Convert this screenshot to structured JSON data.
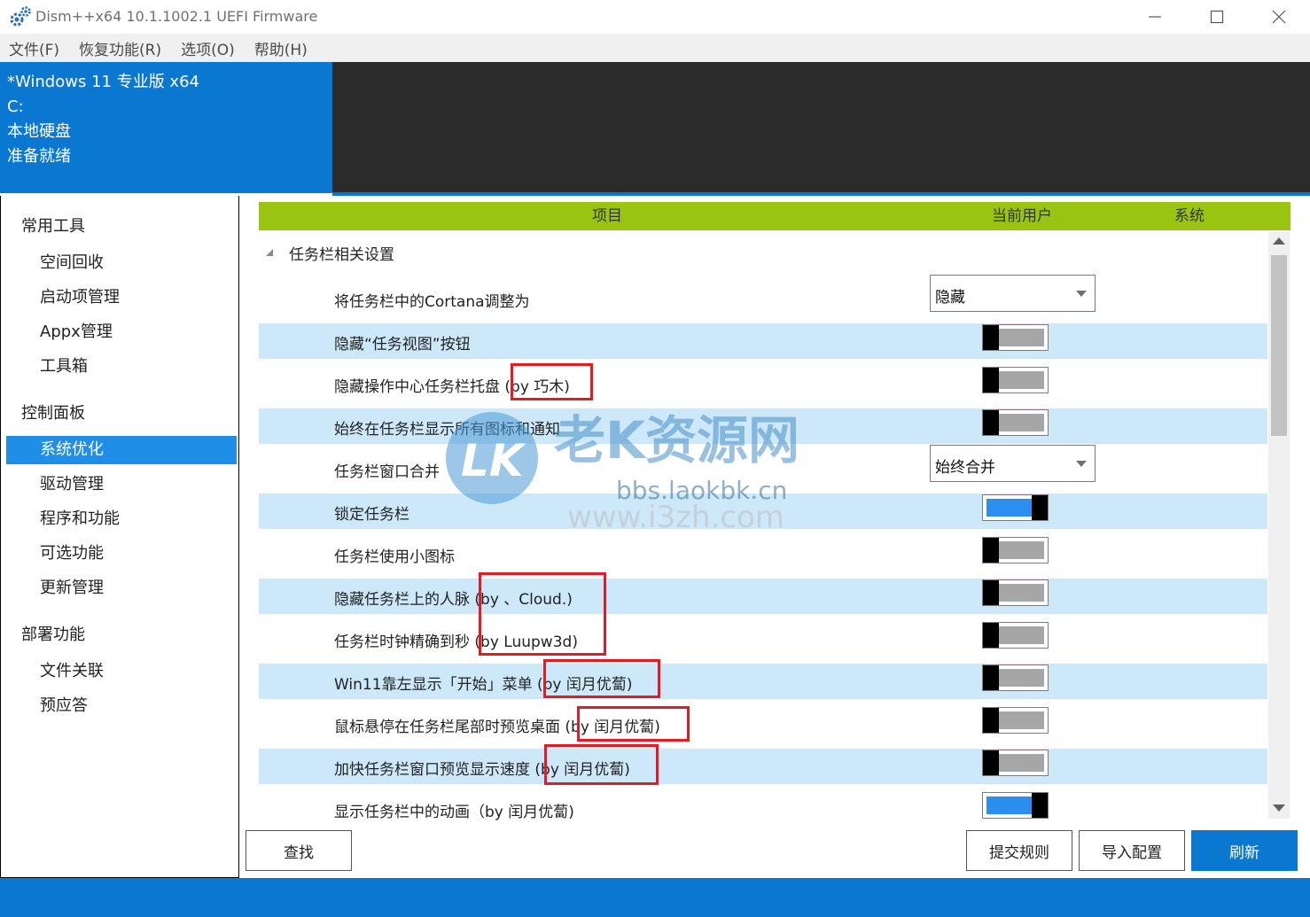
{
  "window": {
    "title": "Dism++x64 10.1.1002.1 UEFI Firmware",
    "minimize_icon": "minimize-icon",
    "maximize_icon": "maximize-icon",
    "close_icon": "close-icon"
  },
  "menu": [
    "文件(F)",
    "恢复功能(R)",
    "选项(O)",
    "帮助(H)"
  ],
  "image_info": {
    "name": "*Windows 11 专业版 x64",
    "drive": "C:",
    "type": "本地硬盘",
    "status": "准备就绪"
  },
  "sidebar": {
    "groups": [
      {
        "label": "常用工具",
        "items": [
          "空间回收",
          "启动项管理",
          "Appx管理",
          "工具箱"
        ]
      },
      {
        "label": "控制面板",
        "items": [
          "系统优化",
          "驱动管理",
          "程序和功能",
          "可选功能",
          "更新管理"
        ]
      },
      {
        "label": "部署功能",
        "items": [
          "文件关联",
          "预应答"
        ]
      }
    ],
    "active": "系统优化"
  },
  "table": {
    "columns": [
      "项目",
      "当前用户",
      "系统"
    ],
    "group_title": "任务栏相关设置",
    "rows": [
      {
        "label": "将任务栏中的Cortana调整为",
        "control": "dropdown",
        "value": "隐藏"
      },
      {
        "label": "隐藏“任务视图”按钮",
        "control": "toggle",
        "on": false
      },
      {
        "label": "隐藏操作中心任务栏托盘",
        "credit": "(by 巧木)",
        "control": "toggle",
        "on": false
      },
      {
        "label": "始终在任务栏显示所有图标和通知",
        "control": "toggle",
        "on": false
      },
      {
        "label": "任务栏窗口合并",
        "control": "dropdown",
        "value": "始终合并"
      },
      {
        "label": "锁定任务栏",
        "control": "toggle",
        "on": true
      },
      {
        "label": "任务栏使用小图标",
        "control": "toggle",
        "on": false
      },
      {
        "label": "隐藏任务栏上的人脉",
        "credit": "(by 、Cloud.)",
        "control": "toggle",
        "on": false
      },
      {
        "label": "任务栏时钟精确到秒",
        "credit": "(by Luupw3d)",
        "control": "toggle",
        "on": false
      },
      {
        "label": "Win11靠左显示「开始」菜单",
        "credit": "(by 闰月优蔔)",
        "control": "toggle",
        "on": false
      },
      {
        "label": "鼠标悬停在任务栏尾部时预览桌面",
        "credit": "(by 闰月优蔔)",
        "control": "toggle",
        "on": false
      },
      {
        "label": "加快任务栏窗口预览显示速度",
        "credit": "(by 闰月优蔔)",
        "control": "toggle",
        "on": false
      },
      {
        "label": "显示任务栏中的动画（by 闰月优蔔)",
        "control": "toggle",
        "on": true
      }
    ]
  },
  "buttons": {
    "find": "查找",
    "submit_rule": "提交规则",
    "import_config": "导入配置",
    "refresh": "刷新"
  },
  "watermark": {
    "title": "老K资源网",
    "url": "bbs.laokbk.cn",
    "url2": "www.i3zh.com",
    "logo": "LK"
  },
  "colors": {
    "accent": "#0a78d0",
    "header_bar": "#99c512",
    "alt_row": "#cce8f9",
    "toggle_on": "#2a8fef",
    "highlight_box": "#e21b25"
  }
}
